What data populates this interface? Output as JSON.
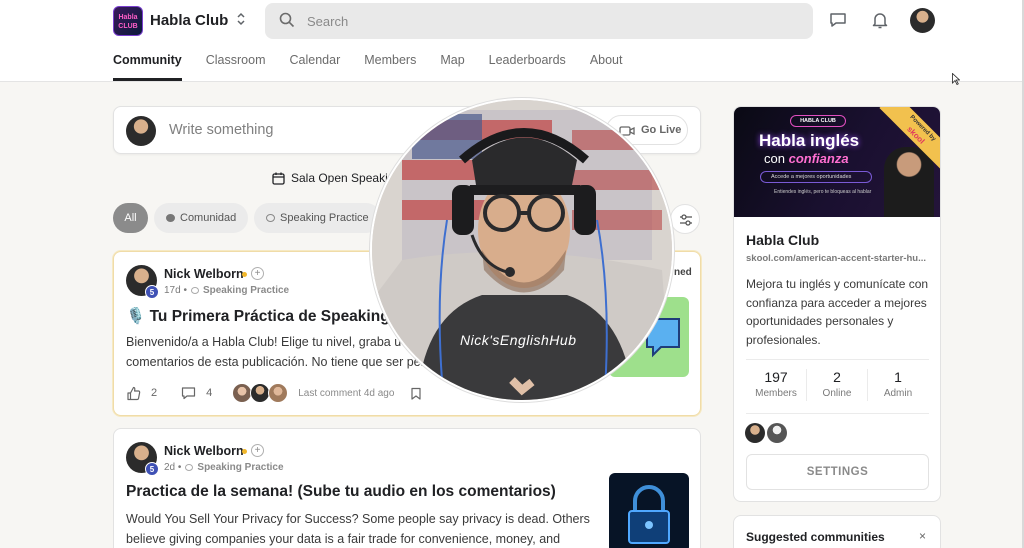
{
  "app": {
    "name": "Habla Club",
    "logo_text": "Habla CLUB"
  },
  "search": {
    "placeholder": "Search"
  },
  "tabs": [
    {
      "label": "Community",
      "active": true
    },
    {
      "label": "Classroom"
    },
    {
      "label": "Calendar"
    },
    {
      "label": "Members"
    },
    {
      "label": "Map"
    },
    {
      "label": "Leaderboards"
    },
    {
      "label": "About"
    }
  ],
  "composer": {
    "placeholder": "Write something",
    "go_live_label": "Go Live"
  },
  "event": {
    "label": "Sala Open Speaki"
  },
  "filters": {
    "all": "All",
    "comunidad": "Comunidad",
    "speaking": "Speaking Practice"
  },
  "posts": [
    {
      "author": "Nick Welborn",
      "level": "5",
      "age": "17d",
      "category": "Speaking Practice",
      "pinned_label": "ned",
      "title": "🎙️ Tu Primera Práctica de Speaking",
      "body_lines": [
        "Bienvenido/a a Habla Club! Elige tu nivel, graba u",
        "comentarios de esta publicación. No tiene que ser per"
      ],
      "likes": "2",
      "comments": "4",
      "last_comment": "Last comment 4d ago"
    },
    {
      "author": "Nick Welborn",
      "level": "5",
      "age": "2d",
      "category": "Speaking Practice",
      "title": "Practica de la semana! (Sube tu audio en los comentarios)",
      "body_lines": [
        "Would You Sell Your Privacy for Success? Some people say privacy is dead. Others",
        "believe giving companies your data is a fair trade for convenience, money, and"
      ]
    }
  ],
  "webcam": {
    "hoodie_text": "Nick'sEnglishHub"
  },
  "sidebar": {
    "banner": {
      "pill": "HABLA CLUB",
      "headline": "Habla inglés",
      "sub_prefix": "con",
      "sub_emph": "confianza",
      "pill2": "Accede a mejores oportunidades",
      "note": "Entiendes inglés, pero te bloqueas al hablar",
      "ribbon_top": "Powered by",
      "ribbon_brand": "skool"
    },
    "title": "Habla Club",
    "url": "skool.com/american-accent-starter-hu...",
    "description": "Mejora tu inglés y comunícate con confianza para acceder a mejores oportunidades personales y profesionales.",
    "stats": [
      {
        "value": "197",
        "label": "Members"
      },
      {
        "value": "2",
        "label": "Online"
      },
      {
        "value": "1",
        "label": "Admin"
      }
    ],
    "settings_label": "SETTINGS"
  },
  "suggested": {
    "title": "Suggested communities",
    "close": "×"
  },
  "colors": {
    "accent_gold": "#f1b72b",
    "level_badge": "#3f51b5",
    "brand_pink": "#ff5ec8"
  }
}
